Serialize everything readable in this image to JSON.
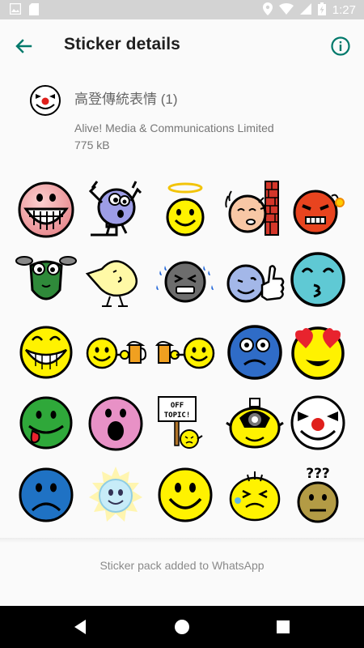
{
  "status_bar": {
    "time": "1:27",
    "icons": [
      "image-icon",
      "sd-card-icon",
      "location-icon",
      "wifi-icon",
      "battery-charging-icon"
    ]
  },
  "app_bar": {
    "title": "Sticker details",
    "back_icon": "back-arrow-icon",
    "info_icon": "info-icon"
  },
  "pack": {
    "name": "高登傳統表情 (1)",
    "publisher": "Alive! Media & Communications Limited",
    "size": "775 kB",
    "icon": "clown-face-icon"
  },
  "stickers": [
    "big-grin-face",
    "purple-creature-climbing",
    "angel-smiley",
    "face-hitting-brick-wall",
    "angry-bomb-face",
    "green-frog-creature",
    "yellow-bird-creature",
    "crying-gray-face",
    "thumbs-up-smiley",
    "kissing-cyan-face",
    "toothy-yellow-grin",
    "smiley-holding-beer",
    "smiley-with-beer",
    "blue-shocked-face",
    "heart-eyes-face",
    "green-tongue-face",
    "pink-surprised-face",
    "off-topic-sign-smiley",
    "camera-yellow-smiley",
    "clown-face",
    "sad-blue-face",
    "sun-glowing-face",
    "classic-yellow-smiley",
    "squinting-drooling-face",
    "confused-question-face",
    "partial-row",
    "partial-row",
    "partial-row",
    "partial-row",
    "partial-row"
  ],
  "sign_text": "OFF TOPIC!",
  "question_text": "???",
  "footer": {
    "status_text": "Sticker pack added to WhatsApp"
  },
  "colors": {
    "accent": "#00796b",
    "status_bar": "#d3d3d3",
    "nav_bar": "#000000"
  }
}
